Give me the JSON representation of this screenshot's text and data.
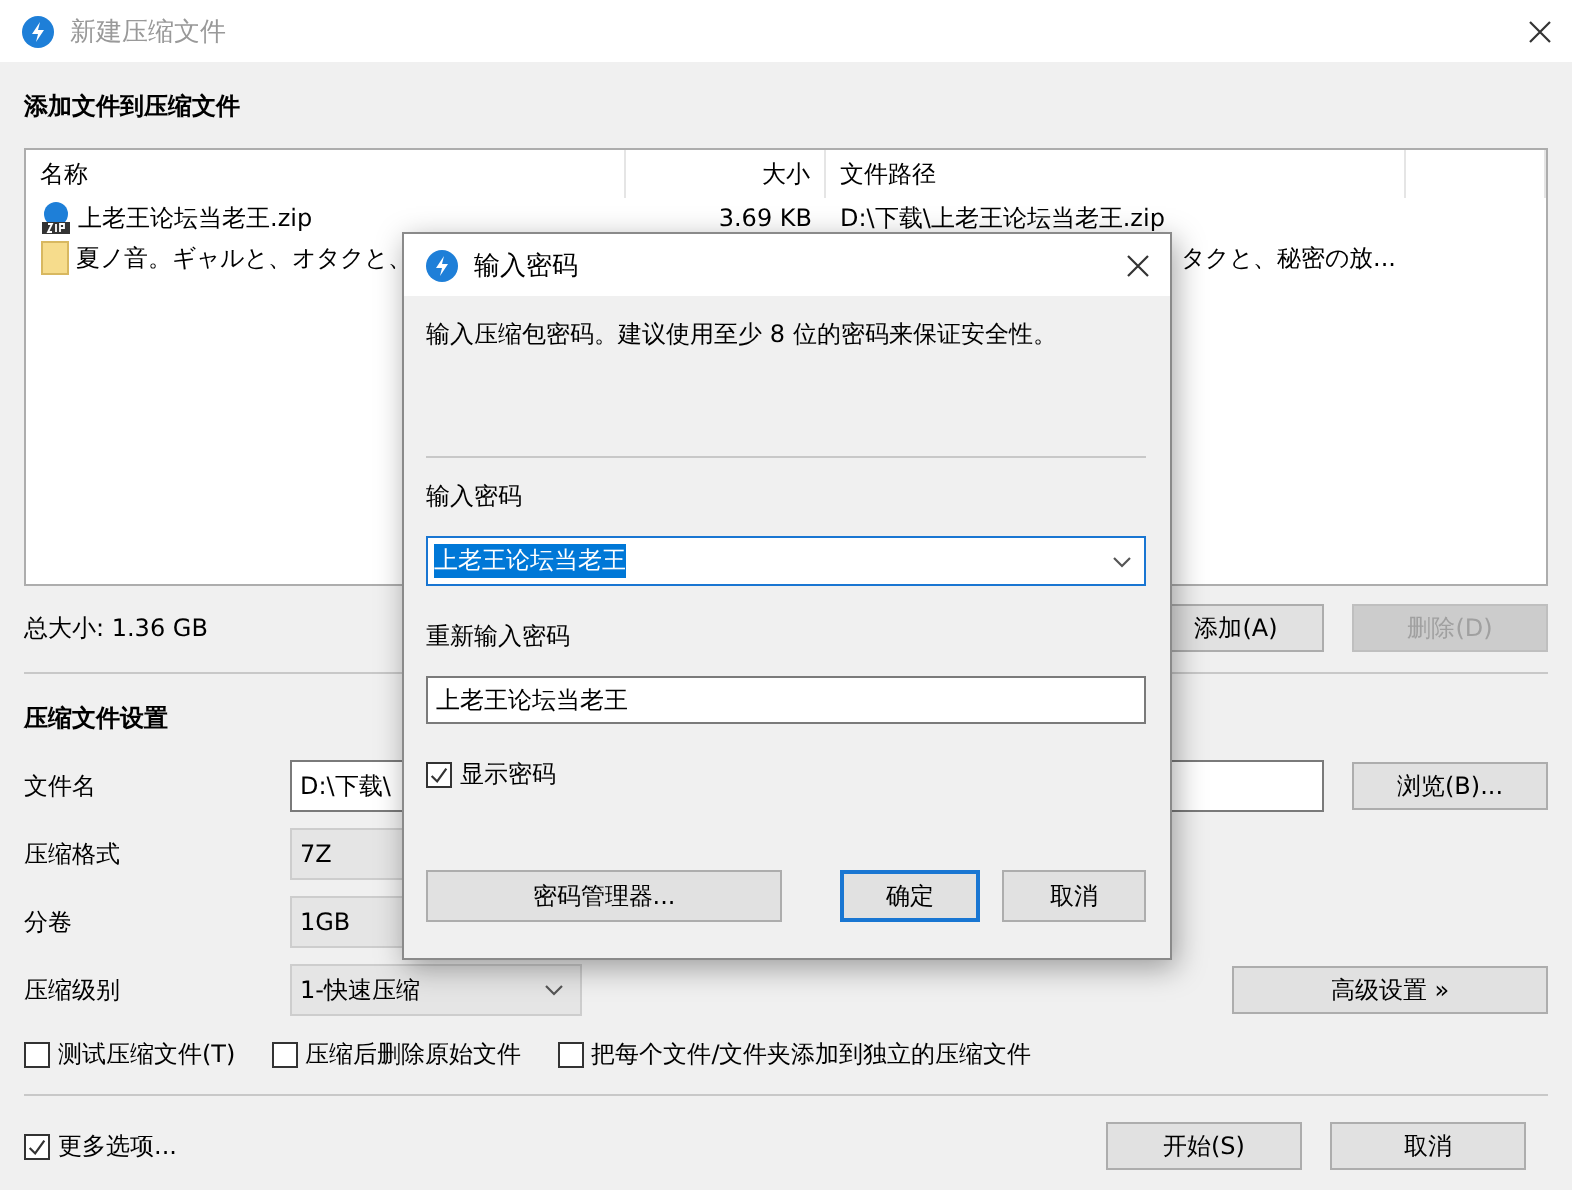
{
  "window": {
    "title": "新建压缩文件"
  },
  "add_section": {
    "heading": "添加文件到压缩文件",
    "columns": [
      "名称",
      "大小",
      "文件路径"
    ],
    "rows": [
      {
        "kind": "zip",
        "name": "上老王论坛当老王.zip",
        "size": "3.69 KB",
        "path": "D:\\下载\\上老王论坛当老王.zip"
      },
      {
        "kind": "folder",
        "name": "夏ノ音。ギャルと、オタクと、",
        "path": "タクと、秘密の放..."
      }
    ],
    "total": "总大小: 1.36 GB",
    "buttons": [
      {
        "label": "添加(A)",
        "disabled": false
      },
      {
        "label": "删除(D)",
        "disabled": true
      }
    ]
  },
  "settings": {
    "heading": "压缩文件设置",
    "fields": [
      {
        "kind": "text",
        "label": "文件名",
        "value": "D:\\下载\\",
        "button": "浏览(B)..."
      },
      {
        "kind": "select",
        "label": "压缩格式",
        "value": "7Z"
      },
      {
        "kind": "select",
        "label": "分卷",
        "value": "1GB"
      },
      {
        "kind": "dropdown",
        "label": "压缩级别",
        "value": "1-快速压缩",
        "button": "高级设置 »"
      }
    ],
    "options": [
      {
        "label": "测试压缩文件(T)",
        "checked": false
      },
      {
        "label": "压缩后删除原始文件",
        "checked": false
      },
      {
        "label": "把每个文件/文件夹添加到独立的压缩文件",
        "checked": false
      }
    ]
  },
  "more_options": {
    "label": "更多选项...",
    "checked": true
  },
  "footer_buttons": [
    "开始(S)",
    "取消"
  ],
  "dialog": {
    "title": "输入密码",
    "message": "输入压缩包密码。建议使用至少 8 位的密码来保证安全性。",
    "password_label": "输入密码",
    "password": "上老王论坛当老王",
    "confirm_label": "重新输入密码",
    "confirm": "上老王论坛当老王",
    "show_password": {
      "label": "显示密码",
      "checked": true
    },
    "buttons": [
      {
        "label": "密码管理器...",
        "default": false
      },
      {
        "label": "确定",
        "default": true
      },
      {
        "label": "取消",
        "default": false
      }
    ]
  }
}
